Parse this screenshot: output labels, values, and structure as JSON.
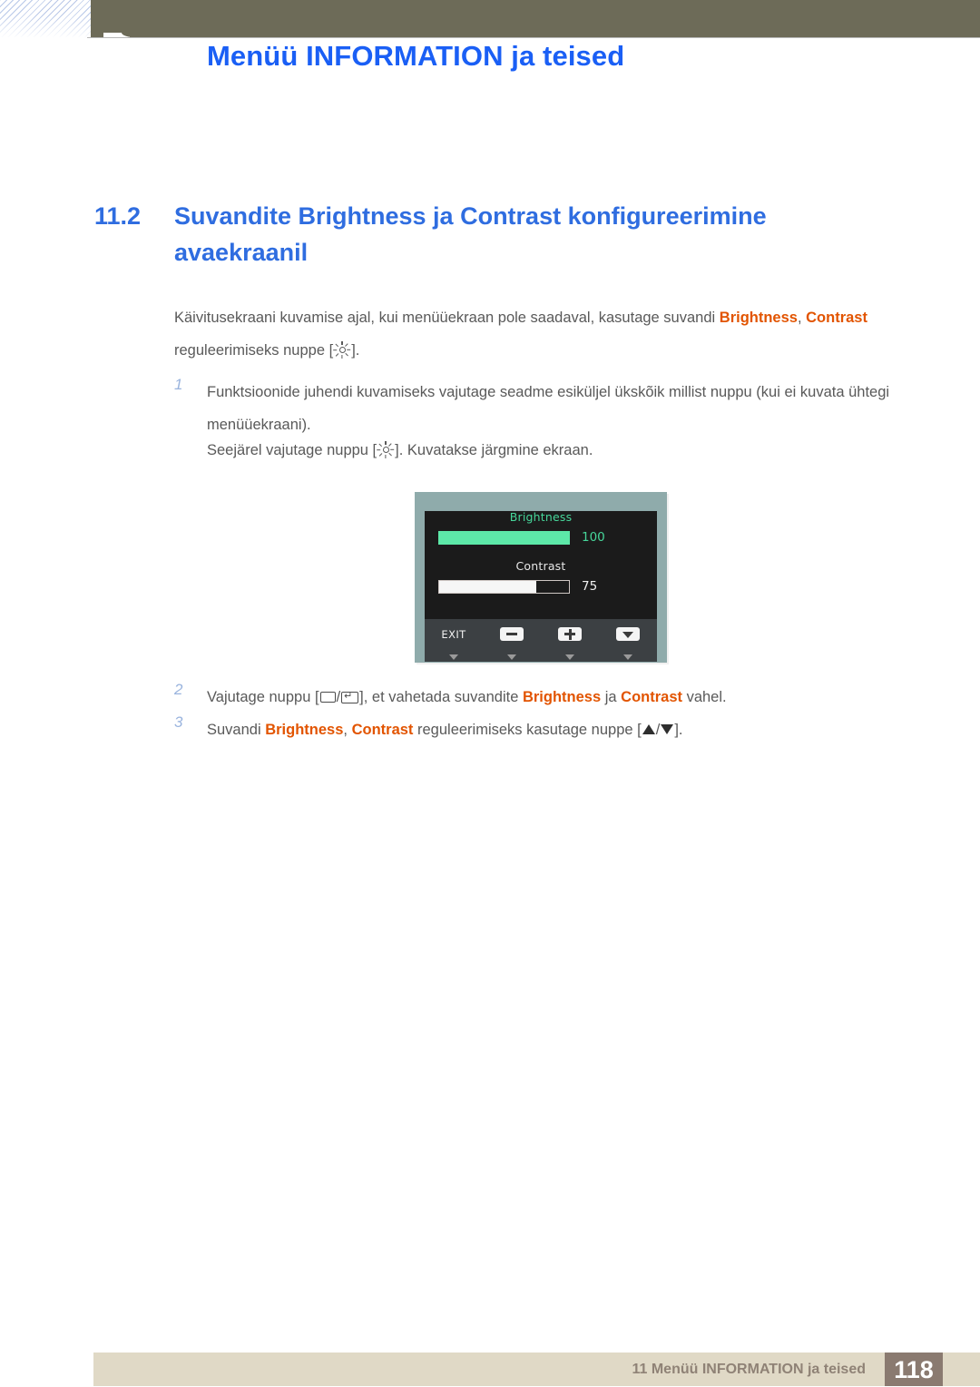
{
  "header": {
    "title": "Menüü INFORMATION ja teised"
  },
  "section": {
    "number": "11.2",
    "title": "Suvandite Brightness ja Contrast konfigureerimine avaekraanil"
  },
  "intro": {
    "part1": "Käivitusekraani kuvamise ajal, kui menüüekraan pole saadaval, kasutage suvandi ",
    "kw1": "Brightness",
    "comma1": ", ",
    "kw2": "Contrast",
    "part2": "",
    "line2_pre": "reguleerimiseks nuppe [",
    "line2_post": "].",
    "icon1": "brightness-sun-icon"
  },
  "steps": [
    {
      "number": "1",
      "text": "Funktsioonide juhendi kuvamiseks vajutage seadme esiküljel ükskõik millist nuppu (kui ei kuvata ühtegi menüüekraani).",
      "extra_pre": "Seejärel vajutage nuppu [",
      "extra_post": "]. Kuvatakse järgmine ekraan.",
      "icon": "brightness-sun-icon"
    },
    {
      "number": "2",
      "pre": "Vajutage nuppu [",
      "sep": "/",
      "post": "], et vahetada suvandite ",
      "kw1": "Brightness",
      "mid": " ja ",
      "kw2": "Contrast",
      "tail": " vahel.",
      "icon_a": "menu-button-icon",
      "icon_b": "enter-button-icon"
    },
    {
      "number": "3",
      "pre": "Suvandi ",
      "kw1": "Brightness",
      "comma": ", ",
      "kw2": "Contrast",
      "mid": " reguleerimiseks kasutage nuppe [",
      "sep": "/",
      "tail": "].",
      "icon_a": "arrow-up-icon",
      "icon_b": "arrow-down-icon"
    }
  ],
  "osd": {
    "brightness_label": "Brightness",
    "brightness_value": "100",
    "brightness_percent": 100,
    "contrast_label": "Contrast",
    "contrast_value": "75",
    "contrast_percent": 75,
    "exit_label": "EXIT",
    "buttons": [
      {
        "name": "exit-button",
        "kind": "text"
      },
      {
        "name": "minus-button",
        "kind": "cap-minus"
      },
      {
        "name": "plus-button",
        "kind": "cap-plus"
      },
      {
        "name": "down-button",
        "kind": "cap-down"
      }
    ],
    "colors": {
      "frame": "#8fabab",
      "screen": "#1b1b1b",
      "brightness_bar": "#5de8a8",
      "brightness_text": "#46d69a",
      "contrast_bar": "#f6f6f6",
      "bottom_bar": "#3c4043"
    }
  },
  "footer": {
    "text": "11 Menüü INFORMATION ja teised",
    "page": "118"
  },
  "colors": {
    "header_band": "#6d6b58",
    "header_title": "#1a5ff5",
    "heading": "#2f6de0",
    "body": "#595959",
    "keyword": "#e25400",
    "step_number": "#9ab4de",
    "footer_bar": "#e0d9c6",
    "footer_text": "#8f8276",
    "page_box": "#8a7a70"
  }
}
